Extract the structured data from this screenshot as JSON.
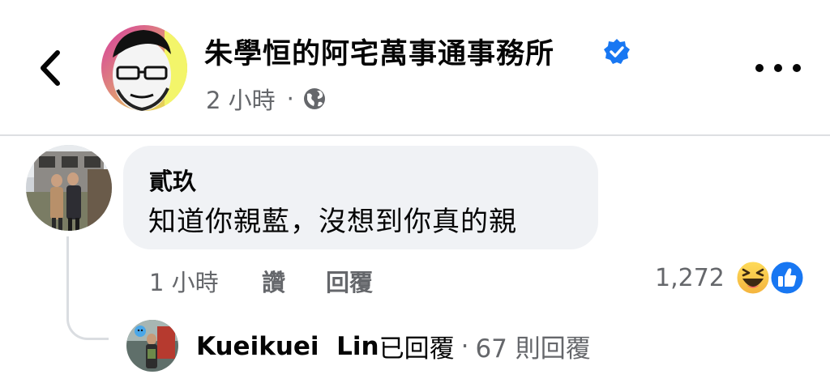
{
  "header": {
    "back_icon": "chevron-left-icon",
    "page_name": "朱學恒的阿宅萬事通事務所",
    "verified_icon": "verified-badge-icon",
    "time": "2 小時",
    "separator": "·",
    "audience_icon": "globe-icon",
    "more_icon": "more-horizontal-icon"
  },
  "comment": {
    "author": "貳玖",
    "text": "知道你親藍，沒想到你真的親",
    "time": "1 小時",
    "like_label": "讚",
    "reply_label": "回覆",
    "reaction_count": "1,272",
    "reaction_icons": [
      "haha-reaction-icon",
      "like-reaction-icon"
    ]
  },
  "reply_summary": {
    "name": "Kueikuei  Lin",
    "action": "已回覆",
    "separator": "·",
    "count": "67 則回覆"
  },
  "colors": {
    "accent": "#1877f2",
    "secondary_text": "#65676b",
    "bubble": "#f0f2f5"
  }
}
